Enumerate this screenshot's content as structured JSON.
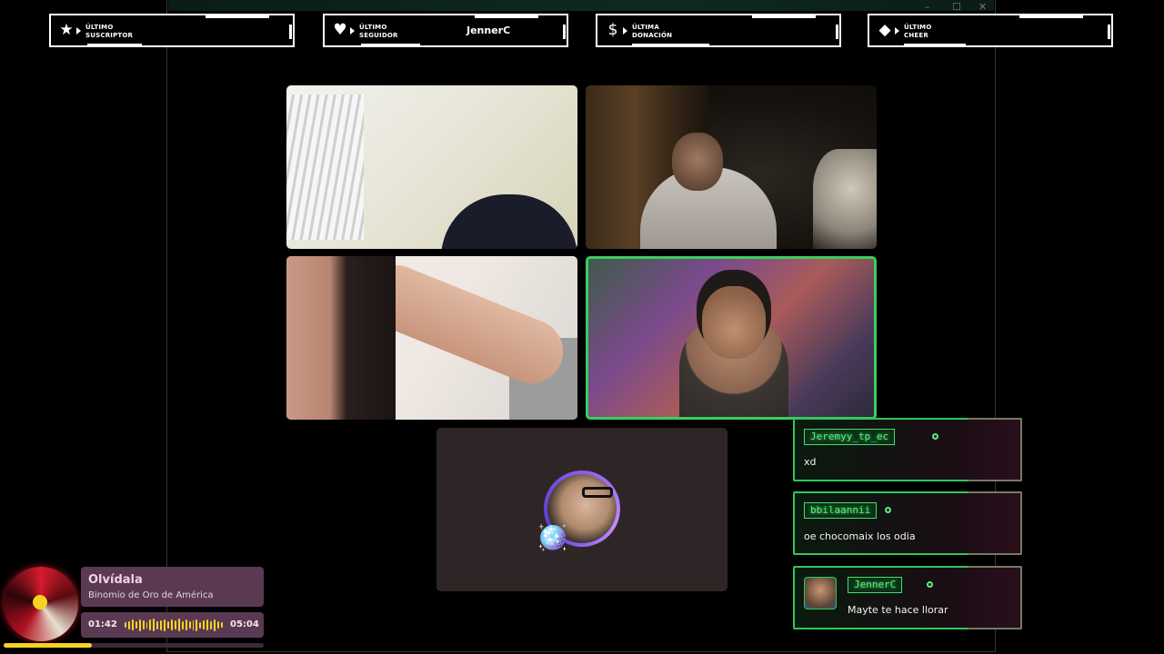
{
  "window": {
    "min_icon": "minimize-icon",
    "max_icon": "maximize-icon",
    "close_icon": "close-icon"
  },
  "alerts": [
    {
      "label": "ÚLTIMO\nSUSCRIPTOR",
      "value": "",
      "icon": "star-icon",
      "glyph": "★"
    },
    {
      "label": "ÚLTIMO\nSEGUIDOR",
      "value": "JennerC",
      "icon": "heart-icon",
      "glyph": "♥"
    },
    {
      "label": "ÚLTIMA\nDONACIÓN",
      "value": "",
      "icon": "dollar-icon",
      "glyph": "$"
    },
    {
      "label": "ÚLTIMO\nCHEER",
      "value": "",
      "icon": "diamond-icon",
      "glyph": "◆"
    }
  ],
  "chat": [
    {
      "user": "Jeremyy_tp_ec",
      "text": "xd"
    },
    {
      "user": "bbilaannii",
      "text": "oe chocomaix los odia"
    },
    {
      "user": "JennerC",
      "text": "Mayte te hace llorar"
    }
  ],
  "music": {
    "title": "Olvídala",
    "artist": "Binomio de Oro de América",
    "current_time": "01:42",
    "total_time": "05:04",
    "progress": 0.34,
    "accent": "#f5d420"
  },
  "colors": {
    "chat_border": "#2ec85a",
    "speaking_border": "#3ccd5e",
    "avatar_ring": "#8a5cf0"
  }
}
